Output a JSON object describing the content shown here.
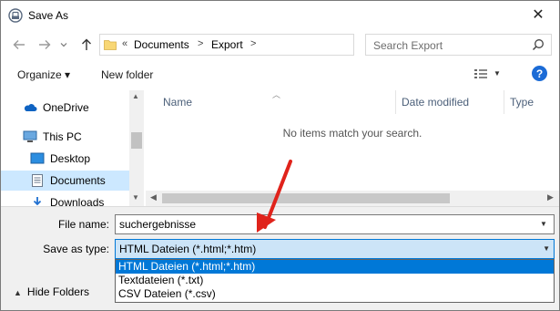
{
  "window": {
    "title": "Save As",
    "close_glyph": "✕"
  },
  "nav": {
    "back_icon": "arrow-left-icon",
    "forward_icon": "arrow-right-icon",
    "recent_icon": "chevron-down-icon",
    "up_icon": "arrow-up-icon",
    "breadcrumb": {
      "overflow": "«",
      "items": [
        "Documents",
        "Export"
      ],
      "separator": ">"
    },
    "search_placeholder": "Search Export"
  },
  "toolbar": {
    "organize_label": "Organize ▾",
    "new_folder_label": "New folder",
    "help_label": "?"
  },
  "sidebar": {
    "items": [
      {
        "label": "OneDrive",
        "icon": "cloud-icon",
        "selected": false
      },
      {
        "label": "This PC",
        "icon": "computer-icon",
        "selected": false
      },
      {
        "label": "Desktop",
        "icon": "desktop-icon",
        "selected": false
      },
      {
        "label": "Documents",
        "icon": "document-icon",
        "selected": true
      },
      {
        "label": "Downloads",
        "icon": "download-icon",
        "selected": false
      }
    ]
  },
  "file_list": {
    "columns": [
      "Name",
      "Date modified",
      "Type"
    ],
    "empty_message": "No items match your search."
  },
  "form": {
    "file_name_label": "File name:",
    "file_name_value": "suchergebnisse",
    "save_type_label": "Save as type:",
    "save_type_value": "HTML Dateien (*.html;*.htm)",
    "type_options": [
      {
        "label": "HTML Dateien (*.html;*.htm)",
        "selected": true
      },
      {
        "label": "Textdateien (*.txt)",
        "selected": false
      },
      {
        "label": "CSV Dateien (*.csv)",
        "selected": false
      }
    ],
    "hide_folders_label": "Hide Folders"
  },
  "colors": {
    "accent": "#0078d7",
    "selection_bg": "#cce8ff",
    "annotation_arrow": "#e0231b"
  }
}
